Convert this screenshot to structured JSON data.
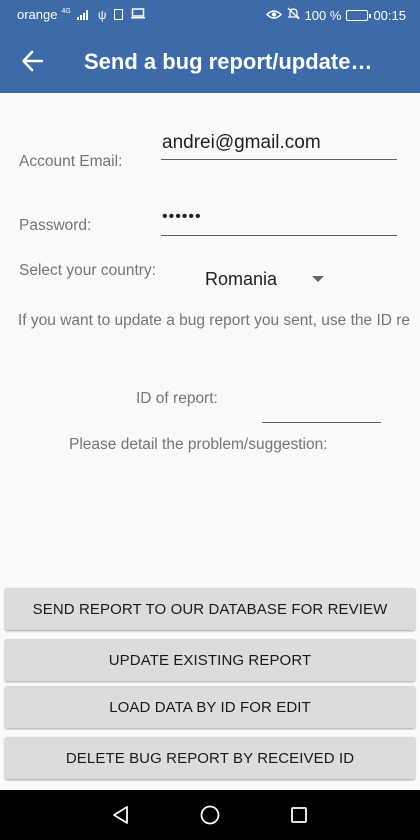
{
  "status_bar": {
    "carrier": "orange",
    "network": "4G",
    "battery_percent": "100 %",
    "time": "00:15"
  },
  "app_bar": {
    "title": "Send a bug report/update…"
  },
  "form": {
    "email_label": "Account Email:",
    "email_value": "andrei@gmail.com",
    "password_label": "Password:",
    "password_value": "••••••",
    "country_label": "Select your country:",
    "country_value": "Romania",
    "info_text": "If you want to update a bug report you sent, use the ID re",
    "report_id_label": "ID of report:",
    "report_id_value": "",
    "detail_label": "Please detail the problem/suggestion:"
  },
  "buttons": {
    "send": "SEND REPORT TO OUR DATABASE FOR REVIEW",
    "update": "UPDATE EXISTING REPORT",
    "load": "LOAD DATA BY ID FOR EDIT",
    "delete": "DELETE BUG REPORT BY RECEIVED ID"
  },
  "colors": {
    "app_bar": "#3d6aa8",
    "background": "#fafafa",
    "button": "#dcdcdc",
    "nav_bar": "#000000"
  }
}
